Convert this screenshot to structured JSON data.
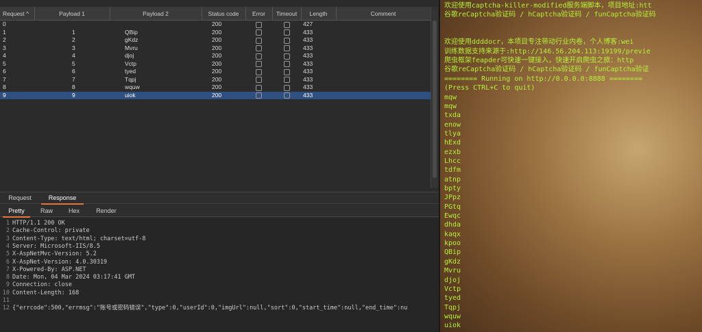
{
  "results": {
    "columns": [
      "Request",
      "Payload 1",
      "Payload 2",
      "Status code",
      "Error",
      "Timeout",
      "Length",
      "Comment"
    ],
    "sort_indicator": "^",
    "rows": [
      {
        "req": "0",
        "p1": "",
        "p2": "",
        "status": "200",
        "len": "427"
      },
      {
        "req": "1",
        "p1": "1",
        "p2": "QBip",
        "status": "200",
        "len": "433"
      },
      {
        "req": "2",
        "p1": "2",
        "p2": "gKdz",
        "status": "200",
        "len": "433"
      },
      {
        "req": "3",
        "p1": "3",
        "p2": "Mvru",
        "status": "200",
        "len": "433"
      },
      {
        "req": "4",
        "p1": "4",
        "p2": "djoj",
        "status": "200",
        "len": "433"
      },
      {
        "req": "5",
        "p1": "5",
        "p2": "Vctp",
        "status": "200",
        "len": "433"
      },
      {
        "req": "6",
        "p1": "6",
        "p2": "tyed",
        "status": "200",
        "len": "433"
      },
      {
        "req": "7",
        "p1": "7",
        "p2": "Tqpj",
        "status": "200",
        "len": "433"
      },
      {
        "req": "8",
        "p1": "8",
        "p2": "wquw",
        "status": "200",
        "len": "433"
      },
      {
        "req": "9",
        "p1": "9",
        "p2": "uiok",
        "status": "200",
        "len": "433"
      }
    ],
    "selected_index": 9
  },
  "tabs": {
    "primary": [
      "Request",
      "Response"
    ],
    "primary_active": 1,
    "secondary": [
      "Pretty",
      "Raw",
      "Hex",
      "Render"
    ],
    "secondary_active": 0
  },
  "response_lines": [
    {
      "n": "1",
      "name": "HTTP/1.1 200 OK",
      "value": ""
    },
    {
      "n": "2",
      "name": "Cache-Control:",
      "value": " private"
    },
    {
      "n": "3",
      "name": "Content-Type:",
      "value": " text/html; charset=utf-8"
    },
    {
      "n": "4",
      "name": "Server:",
      "value": " Microsoft-IIS/8.5"
    },
    {
      "n": "5",
      "name": "X-AspNetMvc-Version:",
      "value": " 5.2"
    },
    {
      "n": "6",
      "name": "X-AspNet-Version:",
      "value": " 4.0.30319"
    },
    {
      "n": "7",
      "name": "X-Powered-By:",
      "value": " ASP.NET"
    },
    {
      "n": "8",
      "name": "Date:",
      "value": " Mon, 04 Mar 2024 03:17:41 GMT"
    },
    {
      "n": "9",
      "name": "Connection:",
      "value": " close"
    },
    {
      "n": "10",
      "name": "Content-Length:",
      "value": " 168"
    },
    {
      "n": "11",
      "name": "",
      "value": ""
    },
    {
      "n": "12",
      "name": "{\"errcode\":500,\"errmsg\":\"账号或密码错误\",\"type\":0,\"userId\":0,\"imgUrl\":null,\"sort\":0,\"start_time\":null,\"end_time\":nu",
      "value": ""
    }
  ],
  "terminal_lines": [
    "欢迎使用captcha-killer-modified服务端脚本，项目地址:htt",
    "谷歌reCaptcha验证码 / hCaptcha验证码 / funCaptcha验证码",
    "",
    "",
    "欢迎使用ddddocr，本项目专注带动行业内卷，个人博客:wei",
    "训练数据支持来源于:http://146.56.204.113:19199/previe",
    "爬虫框架feapder可快速一键接入，快速开启爬虫之旅：http",
    "谷歌reCaptcha验证码 / hCaptcha验证码 / funCaptcha验证",
    "======== Running on http://0.0.0.0:8888 ========",
    "(Press CTRL+C to quit)",
    "mqw",
    "mqw",
    "txda",
    "enow",
    "tlya",
    "hExd",
    "ezxb",
    "Lhcc",
    "tdfm",
    "atnp",
    "bpty",
    "JPpz",
    "PGtq",
    "Ewqc",
    "dhda",
    "kaqx",
    "kpoo",
    "QBip",
    "gKdz",
    "Mvru",
    "djoj",
    "Vctp",
    "tyed",
    "Tqpj",
    "wquw",
    "uiok"
  ]
}
